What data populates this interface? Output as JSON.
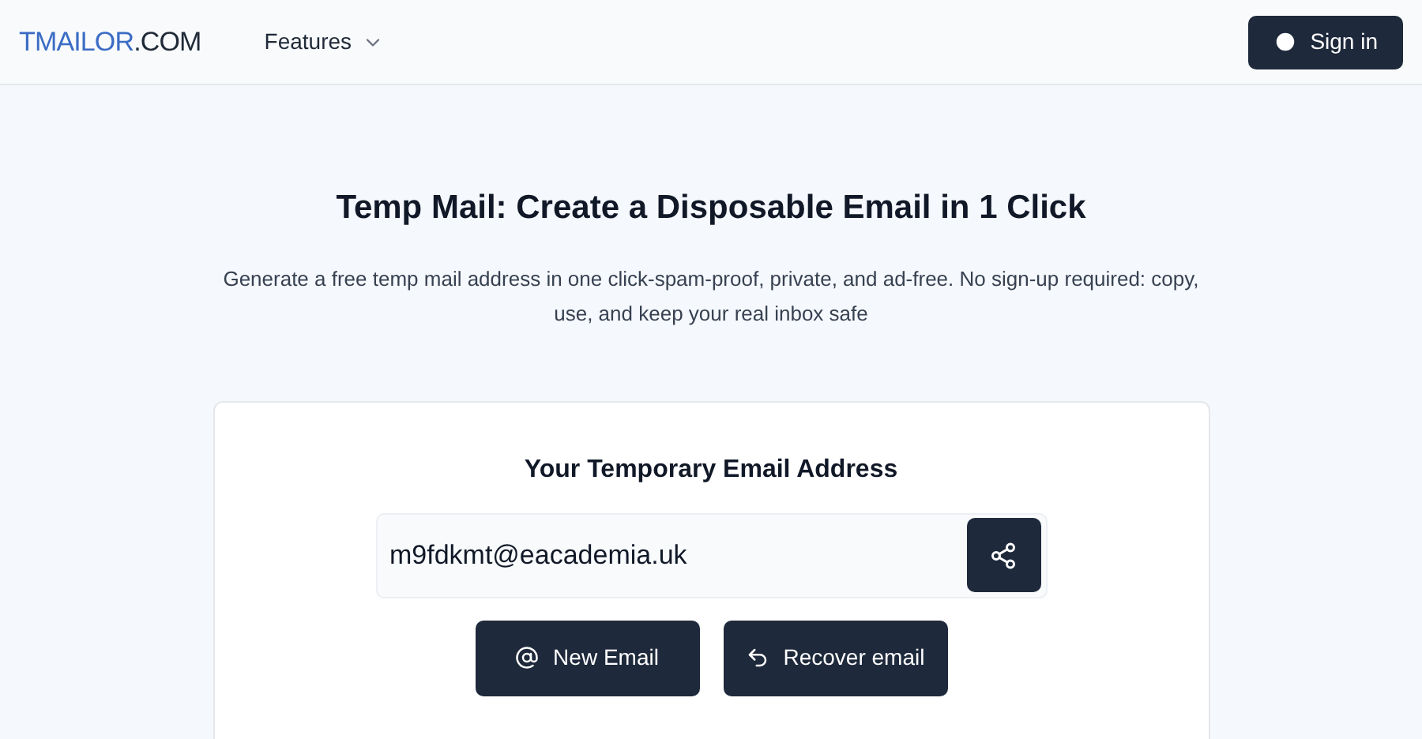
{
  "header": {
    "brand": {
      "name": "TMAILOR",
      "suffix": ".COM"
    },
    "nav": [
      {
        "label": "Features",
        "kind": "dropdown"
      }
    ],
    "sign_in": "Sign in"
  },
  "hero": {
    "title": "Temp Mail: Create a Disposable Email in 1 Click",
    "description": "Generate a free temp mail address in one click-spam-proof, private, and ad-free. No sign-up required: copy, use, and keep your real inbox safe"
  },
  "card": {
    "heading": "Your Temporary Email Address",
    "email": "m9fdkmt@eacademia.uk",
    "buttons": [
      {
        "label": "New Email",
        "kind": "new"
      },
      {
        "label": "Recover email",
        "kind": "recover"
      }
    ]
  }
}
